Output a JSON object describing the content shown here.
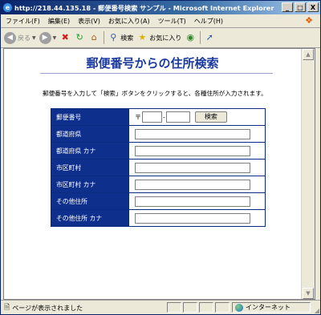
{
  "window": {
    "title": "http://218.44.135.18 - 郵便番号検索 サンプル - Microsoft Internet Explorer",
    "buttons": {
      "minimize": "_",
      "maximize": "□",
      "close": "X"
    }
  },
  "menu": [
    "ファイル(F)",
    "編集(E)",
    "表示(V)",
    "お気に入り(A)",
    "ツール(T)",
    "ヘルプ(H)"
  ],
  "toolbar": {
    "back": "戻る",
    "search": "検索",
    "favorites": "お気に入り"
  },
  "page": {
    "heading": "郵便番号からの住所検索",
    "instruction": "郵便番号を入力して「検索」ボタンをクリックすると、各種住所が入力されます。",
    "form": {
      "postal_label": "郵便番号",
      "postal_mark": "〒",
      "postal_sep": "-",
      "search_button": "検索",
      "rows": [
        {
          "label": "都道府県",
          "value": ""
        },
        {
          "label": "都道府県 カナ",
          "value": ""
        },
        {
          "label": "市区町村",
          "value": ""
        },
        {
          "label": "市区町村 カナ",
          "value": ""
        },
        {
          "label": "その他住所",
          "value": ""
        },
        {
          "label": "その他住所 カナ",
          "value": ""
        }
      ]
    }
  },
  "status": {
    "text": "ページが表示されました",
    "zone": "インターネット"
  },
  "icons": [
    "ie-logo-icon",
    "back-arrow-icon",
    "forward-arrow-icon",
    "stop-icon",
    "refresh-icon",
    "home-icon",
    "search-icon",
    "favorites-star-icon",
    "media-icon",
    "cursor-icon",
    "page-icon",
    "globe-icon"
  ]
}
